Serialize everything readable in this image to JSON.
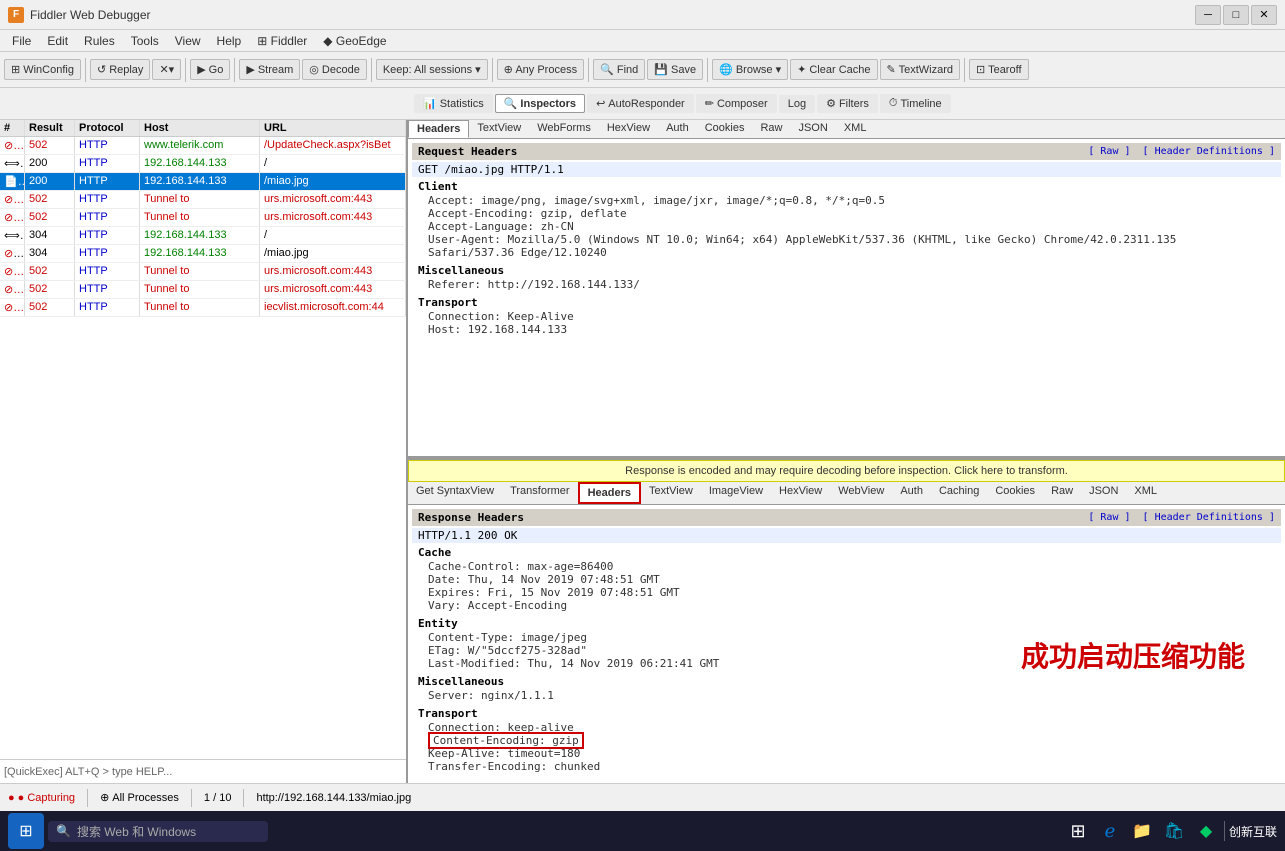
{
  "titleBar": {
    "title": "Fiddler Web Debugger",
    "minimize": "─",
    "maximize": "□",
    "close": "✕"
  },
  "menuBar": {
    "items": [
      "File",
      "Edit",
      "Rules",
      "Tools",
      "View",
      "Help",
      "⊞ Fiddler",
      "◆ GeoEdge"
    ]
  },
  "toolbar": {
    "winconfig": "WinConfig",
    "replay": "↺ Replay",
    "x_btn": "✕▾",
    "go": "▶ Go",
    "stream": "▶ Stream",
    "decode": "◎ Decode",
    "keep": "Keep: All sessions ▾",
    "any_process": "⊕ Any Process",
    "find": "🔍 Find",
    "save": "💾 Save",
    "browse": "🌐 Browse ▾",
    "clear_cache": "✦ Clear Cache",
    "textwizard": "✎ TextWizard",
    "tearoff": "⊡ Tearoff"
  },
  "rightTabs": {
    "statistics": "Statistics",
    "inspectors": "Inspectors",
    "autoresponder": "AutoResponder",
    "composer": "Composer",
    "log": "Log",
    "filters": "Filters",
    "timeline": "Timeline"
  },
  "requestTabs": {
    "headers": "Headers",
    "textview": "TextView",
    "webforms": "WebForms",
    "hexview": "HexView",
    "auth": "Auth",
    "cookies": "Cookies",
    "raw": "Raw",
    "json": "JSON",
    "xml": "XML"
  },
  "requestHeaders": {
    "sectionTitle": "Request Headers",
    "rawLink": "[ Raw ]",
    "headerDefLink": "[ Header Definitions ]",
    "firstLine": "GET /miao.jpg HTTP/1.1",
    "groups": [
      {
        "title": "Client",
        "items": [
          "Accept: image/png, image/svg+xml, image/jxr, image/*;q=0.8, */*;q=0.5",
          "Accept-Encoding: gzip, deflate",
          "Accept-Language: zh-CN",
          "User-Agent: Mozilla/5.0 (Windows NT 10.0; Win64; x64) AppleWebKit/537.36 (KHTML, like Gecko) Chrome/42.0.2311.135 Safari/537.36 Edge/12.10240"
        ]
      },
      {
        "title": "Miscellaneous",
        "items": [
          "Referer: http://192.168.144.133/"
        ]
      },
      {
        "title": "Transport",
        "items": [
          "Connection: Keep-Alive",
          "Host: 192.168.144.133"
        ]
      }
    ]
  },
  "responseBanner": "Response is encoded and may require decoding before inspection. Click here to transform.",
  "responseTabs": {
    "getSyntaxView": "Get SyntaxView",
    "transformer": "Transformer",
    "headers": "Headers",
    "textview": "TextView",
    "imageview": "ImageView",
    "hexview": "HexView",
    "webview": "WebView",
    "auth": "Auth",
    "caching": "Caching",
    "cookies": "Cookies",
    "raw": "Raw",
    "json": "JSON",
    "xml": "XML"
  },
  "responseHeaders": {
    "sectionTitle": "Response Headers",
    "rawLink": "[ Raw ]",
    "headerDefLink": "[ Header Definitions ]",
    "firstLine": "HTTP/1.1 200 OK",
    "groups": [
      {
        "title": "Cache",
        "items": [
          "Cache-Control: max-age=86400",
          "Date: Thu, 14 Nov 2019 07:48:51 GMT",
          "Expires: Fri, 15 Nov 2019 07:48:51 GMT",
          "Vary: Accept-Encoding"
        ]
      },
      {
        "title": "Entity",
        "items": [
          "Content-Type: image/jpeg",
          "ETag: W/\"5dccf275-328ad\"",
          "Last-Modified: Thu, 14 Nov 2019 06:21:41 GMT"
        ]
      },
      {
        "title": "Miscellaneous",
        "items": [
          "Server: nginx/1.1.1"
        ]
      },
      {
        "title": "Transport",
        "items": [
          "Connection: keep-alive",
          "Content-Encoding: gzip",
          "Keep-Alive: timeout=180",
          "Transfer-Encoding: chunked"
        ]
      }
    ],
    "highlightedItem": "Content-Encoding: gzip"
  },
  "chineseAnnotation": "成功启动压缩功能",
  "sessions": [
    {
      "id": "1",
      "result": "502",
      "protocol": "HTTP",
      "host": "www.telerik.com",
      "url": "/UpdateCheck.aspx?isBet",
      "type": "error",
      "icon": "circle-red"
    },
    {
      "id": "2",
      "result": "200",
      "protocol": "HTTP",
      "host": "192.168.144.133",
      "url": "/",
      "type": "selected",
      "icon": "arrow"
    },
    {
      "id": "3",
      "result": "200",
      "protocol": "HTTP",
      "host": "192.168.144.133",
      "url": "/miao.jpg",
      "type": "selected-active",
      "icon": "page"
    },
    {
      "id": "4",
      "result": "502",
      "protocol": "HTTP",
      "host": "Tunnel to",
      "url": "urs.microsoft.com:443",
      "type": "error",
      "icon": "circle-red"
    },
    {
      "id": "5",
      "result": "502",
      "protocol": "HTTP",
      "host": "Tunnel to",
      "url": "urs.microsoft.com:443",
      "type": "error",
      "icon": "circle-red"
    },
    {
      "id": "6",
      "result": "304",
      "protocol": "HTTP",
      "host": "192.168.144.133",
      "url": "/",
      "type": "normal",
      "icon": "arrow"
    },
    {
      "id": "7",
      "result": "304",
      "protocol": "HTTP",
      "host": "192.168.144.133",
      "url": "/miao.jpg",
      "type": "normal",
      "icon": "circle-gray"
    },
    {
      "id": "8",
      "result": "502",
      "protocol": "HTTP",
      "host": "Tunnel to",
      "url": "urs.microsoft.com:443",
      "type": "error",
      "icon": "circle-red"
    },
    {
      "id": "9",
      "result": "502",
      "protocol": "HTTP",
      "host": "Tunnel to",
      "url": "urs.microsoft.com:443",
      "type": "error",
      "icon": "circle-red"
    },
    {
      "id": "10",
      "result": "502",
      "protocol": "HTTP",
      "host": "Tunnel to",
      "url": "iecvlist.microsoft.com:44",
      "type": "error",
      "icon": "circle-red"
    }
  ],
  "statusBar": {
    "capturing": "● Capturing",
    "allProcesses": "All Processes",
    "count": "1 / 10",
    "url": "http://192.168.144.133/miao.jpg"
  },
  "quickExec": "[QuickExec] ALT+Q > type HELP...",
  "taskbar": {
    "searchPlaceholder": "搜索 Web 和 Windows",
    "timeText": "创新互联"
  }
}
